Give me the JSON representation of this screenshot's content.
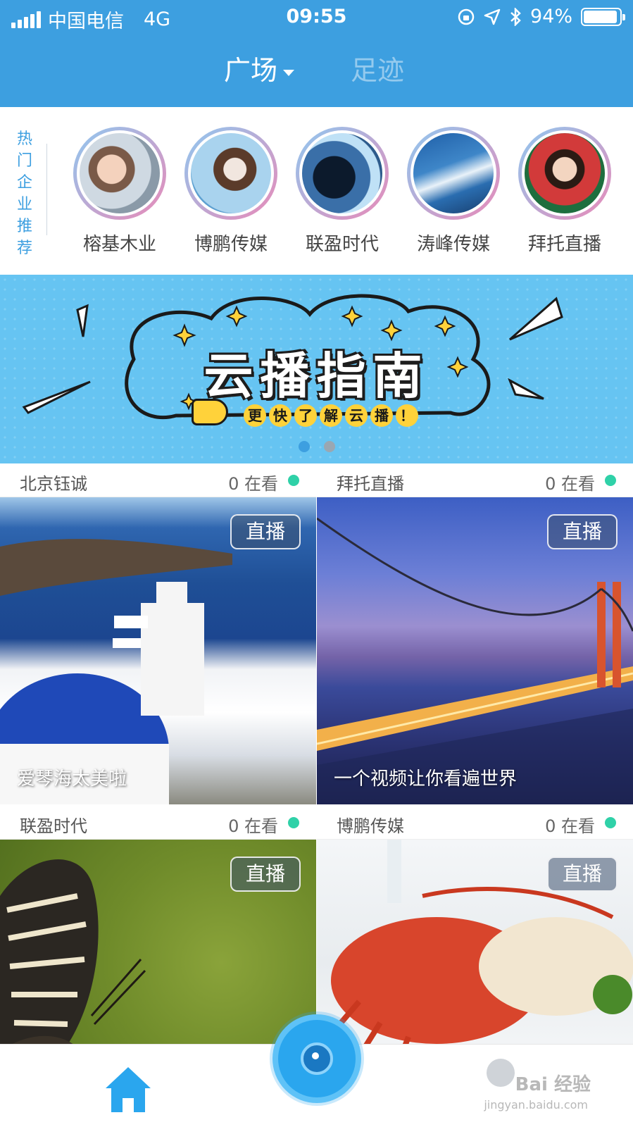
{
  "status_bar": {
    "carrier": "中国电信",
    "network": "4G",
    "time": "09:55",
    "battery": "94%",
    "battery_level": 0.94
  },
  "nav": {
    "tab_square": "广场",
    "tab_footprint": "足迹"
  },
  "hot": {
    "label": "热门企业推荐",
    "companies": [
      {
        "name": "榕基木业"
      },
      {
        "name": "博鹏传媒"
      },
      {
        "name": "联盈时代"
      },
      {
        "name": "涛峰传媒"
      },
      {
        "name": "拜托直播"
      }
    ]
  },
  "banner": {
    "title": "云播指南",
    "subtitle_chars": [
      "更",
      "快",
      "了",
      "解",
      "云",
      "播",
      "！"
    ],
    "active_page": 1,
    "page_count": 2
  },
  "feed": [
    {
      "name": "北京钰诚",
      "viewers": "0 在看",
      "badge": "直播",
      "caption": "爱琴海太美啦"
    },
    {
      "name": "拜托直播",
      "viewers": "0 在看",
      "badge": "直播",
      "caption": "一个视频让你看遍世界"
    },
    {
      "name": "联盈时代",
      "viewers": "0 在看",
      "badge": "直播",
      "caption": ""
    },
    {
      "name": "博鹏传媒",
      "viewers": "0 在看",
      "badge": "直播",
      "caption": ""
    }
  ],
  "watermark": {
    "text": "Bai 经验",
    "sub": "jingyan.baidu.com"
  },
  "colors": {
    "header": "#3d9fe0",
    "accent": "#3d9fe0",
    "live_dot": "#2fd1a8",
    "banner": "#66c4f2"
  },
  "icons": {
    "home": "home-icon",
    "camera": "camera-icon",
    "profile": "profile-icon"
  }
}
